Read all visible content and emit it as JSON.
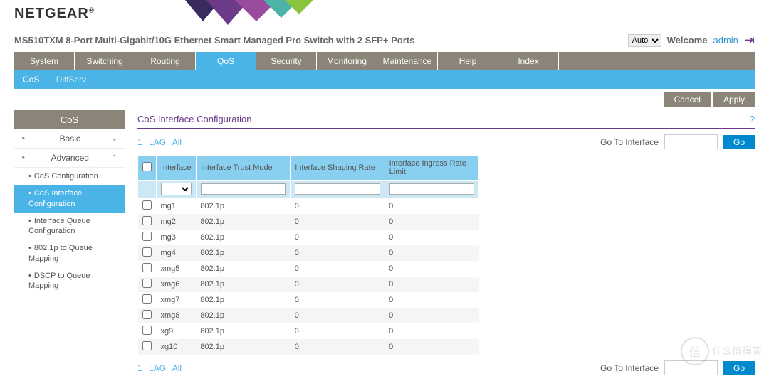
{
  "brand": "NETGEAR",
  "product": "MS510TXM 8-Port Multi-Gigabit/10G Ethernet Smart Managed Pro Switch with 2 SFP+ Ports",
  "lang_select": "Auto",
  "welcome": "Welcome",
  "user": "admin",
  "nav": [
    "System",
    "Switching",
    "Routing",
    "QoS",
    "Security",
    "Monitoring",
    "Maintenance",
    "Help",
    "Index"
  ],
  "nav_active": "QoS",
  "subnav": {
    "active": "CoS",
    "other": "DiffServ"
  },
  "actions": {
    "cancel": "Cancel",
    "apply": "Apply"
  },
  "sidebar": {
    "header": "CoS",
    "basic": "Basic",
    "advanced": "Advanced",
    "items": [
      "CoS Configuration",
      "CoS Interface Configuration",
      "Interface Queue Configuration",
      "802.1p to Queue Mapping",
      "DSCP to Queue Mapping"
    ]
  },
  "page_title": "CoS Interface Configuration",
  "filter": {
    "one": "1",
    "lag": "LAG",
    "all": "All",
    "goto": "Go To Interface",
    "go": "Go"
  },
  "columns": [
    "Interface",
    "Interface Trust Mode",
    "Interface Shaping Rate",
    "Interface Ingress Rate Limit"
  ],
  "rows": [
    {
      "if": "mg1",
      "mode": "802.1p",
      "shape": "0",
      "ingress": "0"
    },
    {
      "if": "mg2",
      "mode": "802.1p",
      "shape": "0",
      "ingress": "0"
    },
    {
      "if": "mg3",
      "mode": "802.1p",
      "shape": "0",
      "ingress": "0"
    },
    {
      "if": "mg4",
      "mode": "802.1p",
      "shape": "0",
      "ingress": "0"
    },
    {
      "if": "xmg5",
      "mode": "802.1p",
      "shape": "0",
      "ingress": "0"
    },
    {
      "if": "xmg6",
      "mode": "802.1p",
      "shape": "0",
      "ingress": "0"
    },
    {
      "if": "xmg7",
      "mode": "802.1p",
      "shape": "0",
      "ingress": "0"
    },
    {
      "if": "xmg8",
      "mode": "802.1p",
      "shape": "0",
      "ingress": "0"
    },
    {
      "if": "xg9",
      "mode": "802.1p",
      "shape": "0",
      "ingress": "0"
    },
    {
      "if": "xg10",
      "mode": "802.1p",
      "shape": "0",
      "ingress": "0"
    }
  ],
  "watermark": "什么值得买"
}
